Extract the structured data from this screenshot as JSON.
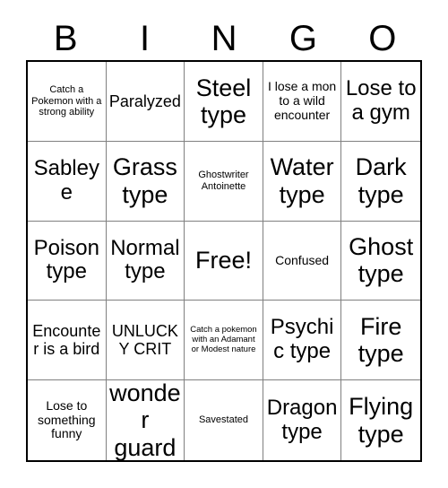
{
  "header": {
    "letters": [
      "B",
      "I",
      "N",
      "G",
      "O"
    ]
  },
  "grid": {
    "rows": 5,
    "columns": 5,
    "cells": [
      {
        "text": "Catch a Pokemon with a strong ability",
        "size": "fs-xs"
      },
      {
        "text": "Paralyzed",
        "size": "fs-md"
      },
      {
        "text": "Steel type",
        "size": "fs-xl"
      },
      {
        "text": "I lose a mon to a wild encounter",
        "size": "fs-sm"
      },
      {
        "text": "Lose to a gym",
        "size": "fs-lg"
      },
      {
        "text": "Sableye",
        "size": "fs-lg"
      },
      {
        "text": "Grass type",
        "size": "fs-xl"
      },
      {
        "text": "Ghostwriter Antoinette",
        "size": "fs-xs"
      },
      {
        "text": "Water type",
        "size": "fs-xl"
      },
      {
        "text": "Dark type",
        "size": "fs-xl"
      },
      {
        "text": "Poison type",
        "size": "fs-lg"
      },
      {
        "text": "Normal type",
        "size": "fs-lg"
      },
      {
        "text": "Free!",
        "size": "fs-xl"
      },
      {
        "text": "Confused",
        "size": "fs-sm"
      },
      {
        "text": "Ghost type",
        "size": "fs-xl"
      },
      {
        "text": "Encounter is a bird",
        "size": "fs-md"
      },
      {
        "text": "UNLUCKY CRIT",
        "size": "fs-md"
      },
      {
        "text": "Catch a pokemon with an Adamant or Modest nature",
        "size": "fs-xxs"
      },
      {
        "text": "Psychic type",
        "size": "fs-lg"
      },
      {
        "text": "Fire type",
        "size": "fs-xl"
      },
      {
        "text": "Lose to something funny",
        "size": "fs-sm"
      },
      {
        "text": "wonder guard",
        "size": "fs-xl"
      },
      {
        "text": "Savestated",
        "size": "fs-xs"
      },
      {
        "text": "Dragon type",
        "size": "fs-lg"
      },
      {
        "text": "Flying type",
        "size": "fs-xl"
      }
    ],
    "free_space_index": 12
  },
  "colors": {
    "background": "#ffffff",
    "text": "#000000",
    "outer_border": "#000000",
    "inner_border": "#808080"
  }
}
